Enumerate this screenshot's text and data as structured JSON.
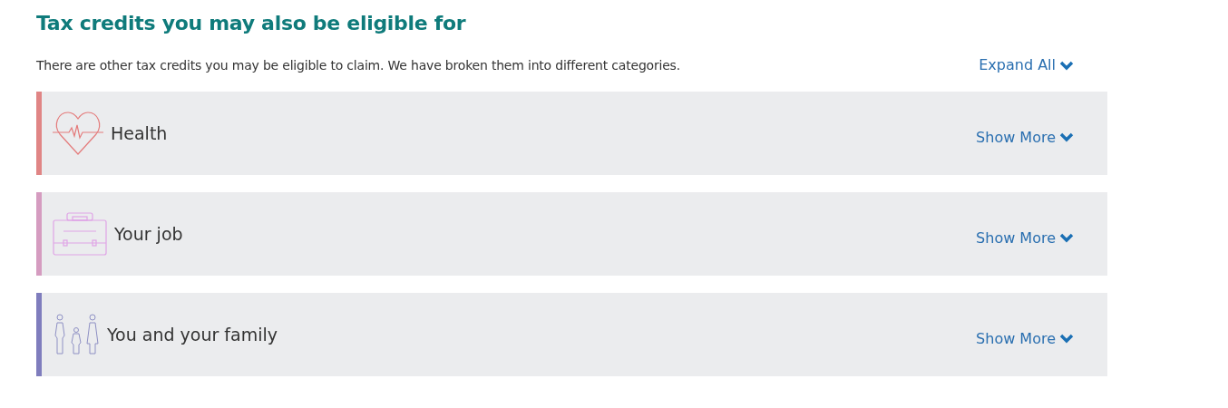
{
  "heading": "Tax credits you may also be eligible for",
  "description": "There are other tax credits you may be eligible to claim. We have broken them into different categories.",
  "expand_all": "Expand All",
  "categories": [
    {
      "kind": "heart",
      "title": "Health",
      "color": "#e08585",
      "toggle": "Show More"
    },
    {
      "kind": "briefcase",
      "title": "Your job",
      "color": "#d59cc0",
      "toggle": "Show More"
    },
    {
      "kind": "family",
      "title": "You and your family",
      "color": "#7f7dbd",
      "toggle": "Show More"
    }
  ]
}
